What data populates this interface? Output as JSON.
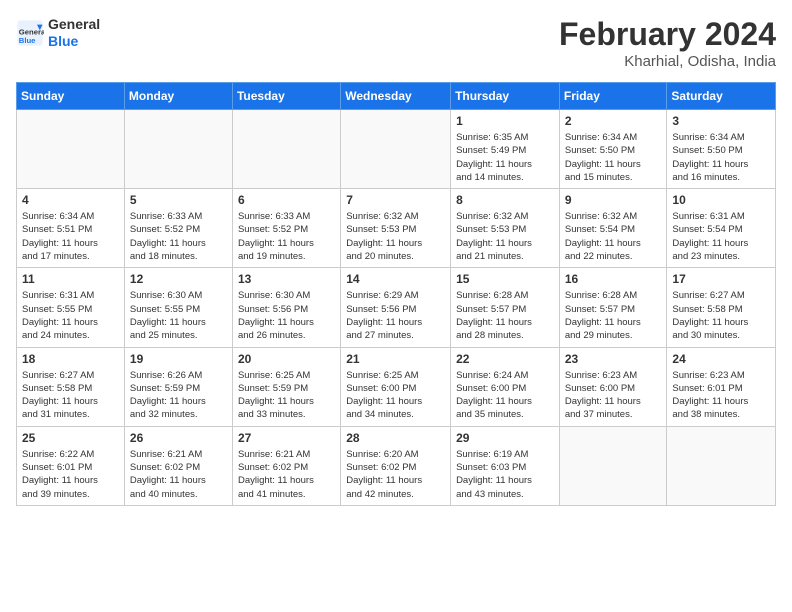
{
  "header": {
    "logo_line1": "General",
    "logo_line2": "Blue",
    "month": "February 2024",
    "location": "Kharhial, Odisha, India"
  },
  "days_of_week": [
    "Sunday",
    "Monday",
    "Tuesday",
    "Wednesday",
    "Thursday",
    "Friday",
    "Saturday"
  ],
  "weeks": [
    [
      {
        "day": "",
        "info": ""
      },
      {
        "day": "",
        "info": ""
      },
      {
        "day": "",
        "info": ""
      },
      {
        "day": "",
        "info": ""
      },
      {
        "day": "1",
        "info": "Sunrise: 6:35 AM\nSunset: 5:49 PM\nDaylight: 11 hours\nand 14 minutes."
      },
      {
        "day": "2",
        "info": "Sunrise: 6:34 AM\nSunset: 5:50 PM\nDaylight: 11 hours\nand 15 minutes."
      },
      {
        "day": "3",
        "info": "Sunrise: 6:34 AM\nSunset: 5:50 PM\nDaylight: 11 hours\nand 16 minutes."
      }
    ],
    [
      {
        "day": "4",
        "info": "Sunrise: 6:34 AM\nSunset: 5:51 PM\nDaylight: 11 hours\nand 17 minutes."
      },
      {
        "day": "5",
        "info": "Sunrise: 6:33 AM\nSunset: 5:52 PM\nDaylight: 11 hours\nand 18 minutes."
      },
      {
        "day": "6",
        "info": "Sunrise: 6:33 AM\nSunset: 5:52 PM\nDaylight: 11 hours\nand 19 minutes."
      },
      {
        "day": "7",
        "info": "Sunrise: 6:32 AM\nSunset: 5:53 PM\nDaylight: 11 hours\nand 20 minutes."
      },
      {
        "day": "8",
        "info": "Sunrise: 6:32 AM\nSunset: 5:53 PM\nDaylight: 11 hours\nand 21 minutes."
      },
      {
        "day": "9",
        "info": "Sunrise: 6:32 AM\nSunset: 5:54 PM\nDaylight: 11 hours\nand 22 minutes."
      },
      {
        "day": "10",
        "info": "Sunrise: 6:31 AM\nSunset: 5:54 PM\nDaylight: 11 hours\nand 23 minutes."
      }
    ],
    [
      {
        "day": "11",
        "info": "Sunrise: 6:31 AM\nSunset: 5:55 PM\nDaylight: 11 hours\nand 24 minutes."
      },
      {
        "day": "12",
        "info": "Sunrise: 6:30 AM\nSunset: 5:55 PM\nDaylight: 11 hours\nand 25 minutes."
      },
      {
        "day": "13",
        "info": "Sunrise: 6:30 AM\nSunset: 5:56 PM\nDaylight: 11 hours\nand 26 minutes."
      },
      {
        "day": "14",
        "info": "Sunrise: 6:29 AM\nSunset: 5:56 PM\nDaylight: 11 hours\nand 27 minutes."
      },
      {
        "day": "15",
        "info": "Sunrise: 6:28 AM\nSunset: 5:57 PM\nDaylight: 11 hours\nand 28 minutes."
      },
      {
        "day": "16",
        "info": "Sunrise: 6:28 AM\nSunset: 5:57 PM\nDaylight: 11 hours\nand 29 minutes."
      },
      {
        "day": "17",
        "info": "Sunrise: 6:27 AM\nSunset: 5:58 PM\nDaylight: 11 hours\nand 30 minutes."
      }
    ],
    [
      {
        "day": "18",
        "info": "Sunrise: 6:27 AM\nSunset: 5:58 PM\nDaylight: 11 hours\nand 31 minutes."
      },
      {
        "day": "19",
        "info": "Sunrise: 6:26 AM\nSunset: 5:59 PM\nDaylight: 11 hours\nand 32 minutes."
      },
      {
        "day": "20",
        "info": "Sunrise: 6:25 AM\nSunset: 5:59 PM\nDaylight: 11 hours\nand 33 minutes."
      },
      {
        "day": "21",
        "info": "Sunrise: 6:25 AM\nSunset: 6:00 PM\nDaylight: 11 hours\nand 34 minutes."
      },
      {
        "day": "22",
        "info": "Sunrise: 6:24 AM\nSunset: 6:00 PM\nDaylight: 11 hours\nand 35 minutes."
      },
      {
        "day": "23",
        "info": "Sunrise: 6:23 AM\nSunset: 6:00 PM\nDaylight: 11 hours\nand 37 minutes."
      },
      {
        "day": "24",
        "info": "Sunrise: 6:23 AM\nSunset: 6:01 PM\nDaylight: 11 hours\nand 38 minutes."
      }
    ],
    [
      {
        "day": "25",
        "info": "Sunrise: 6:22 AM\nSunset: 6:01 PM\nDaylight: 11 hours\nand 39 minutes."
      },
      {
        "day": "26",
        "info": "Sunrise: 6:21 AM\nSunset: 6:02 PM\nDaylight: 11 hours\nand 40 minutes."
      },
      {
        "day": "27",
        "info": "Sunrise: 6:21 AM\nSunset: 6:02 PM\nDaylight: 11 hours\nand 41 minutes."
      },
      {
        "day": "28",
        "info": "Sunrise: 6:20 AM\nSunset: 6:02 PM\nDaylight: 11 hours\nand 42 minutes."
      },
      {
        "day": "29",
        "info": "Sunrise: 6:19 AM\nSunset: 6:03 PM\nDaylight: 11 hours\nand 43 minutes."
      },
      {
        "day": "",
        "info": ""
      },
      {
        "day": "",
        "info": ""
      }
    ]
  ]
}
